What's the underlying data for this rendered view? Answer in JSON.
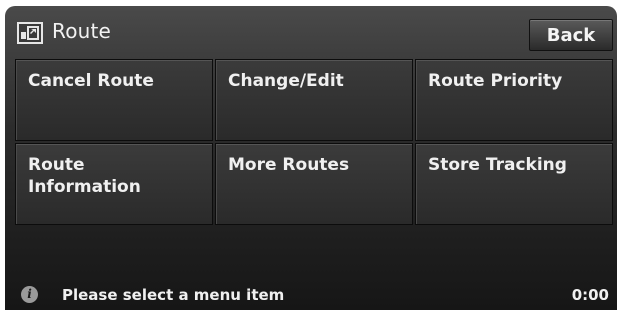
{
  "header": {
    "icon": "route-icon",
    "title": "Route",
    "back_label": "Back"
  },
  "menu": {
    "items": [
      {
        "label": "Cancel Route"
      },
      {
        "label": "Change/Edit"
      },
      {
        "label": "Route Priority"
      },
      {
        "label": "Route\nInformation"
      },
      {
        "label": "More Routes"
      },
      {
        "label": "Store Tracking"
      }
    ]
  },
  "status": {
    "icon": "info-icon",
    "message": "Please select a menu item",
    "time": "0:00"
  }
}
